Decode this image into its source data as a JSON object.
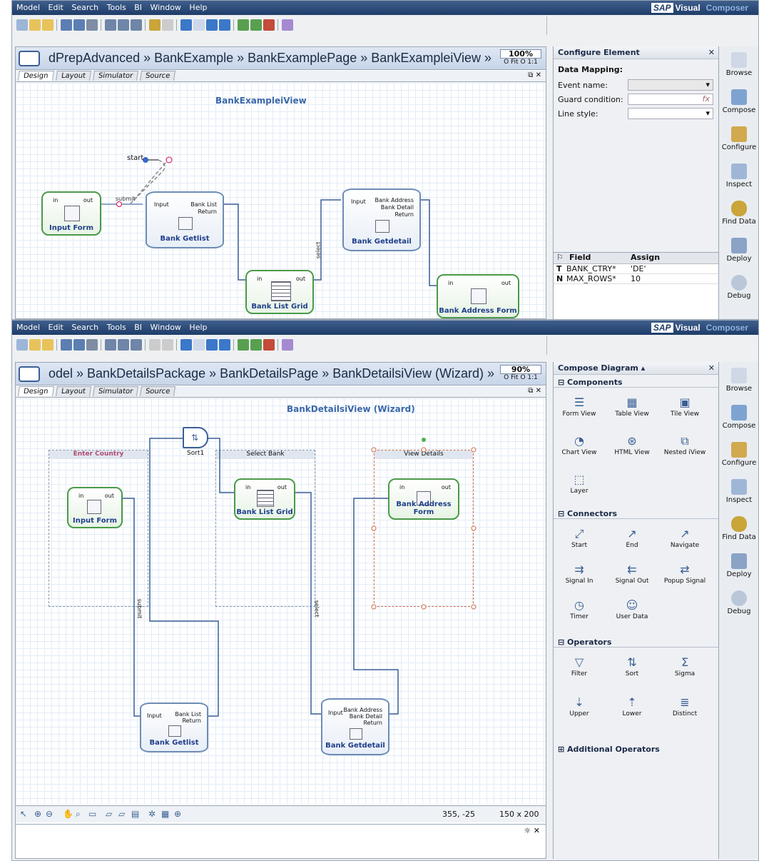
{
  "menu": [
    "Model",
    "Edit",
    "Search",
    "Tools",
    "BI",
    "Window",
    "Help"
  ],
  "brand": {
    "sap": "SAP",
    "vc_a": "Visual",
    "vc_b": "Composer"
  },
  "w1": {
    "breadcrumb": "dPrepAdvanced » BankExample » BankExamplePage » BankExampleiView »",
    "zoom": "100%",
    "fit": "O Fit  O 1:1",
    "tabs": [
      "Design",
      "Layout",
      "Simulator",
      "Source"
    ],
    "view_title": "BankExampleiView",
    "start": "start",
    "submit": "submit",
    "select": "select",
    "input_form": "Input Form",
    "bank_getlist": "Bank Getlist",
    "bank_list_grid": "Bank List Grid",
    "bank_getdetail": "Bank Getdetail",
    "bank_address_form": "Bank Address Form",
    "in": "in",
    "out": "out",
    "input": "Input",
    "bank_list": "Bank List",
    "return": "Return",
    "bank_address": "Bank Address",
    "bank_detail": "Bank Detail",
    "panel": {
      "title": "Configure Element",
      "data_mapping": "Data Mapping:",
      "event_name": "Event name:",
      "guard": "Guard condition:",
      "line_style": "Line style:",
      "fx": "fx",
      "col_field": "Field",
      "col_assign": "Assign",
      "rows": [
        {
          "t": "T",
          "field": "BANK_CTRY*",
          "assign": "'DE'"
        },
        {
          "t": "N",
          "field": "MAX_ROWS*",
          "assign": "10"
        }
      ]
    }
  },
  "w2": {
    "breadcrumb": "odel » BankDetailsPackage » BankDetailsPage » BankDetailsiView (Wizard) »",
    "zoom": "90%",
    "fit": "O Fit  O 1:1",
    "view_title": "BankDetailsiView (Wizard)",
    "enter_country": "Enter Country",
    "select_bank": "Select Bank",
    "view_details": "View Details",
    "sort": "Sort1",
    "submit": "submit",
    "select": "select",
    "status_pos": "355, -25",
    "status_size": "150 x 200",
    "panel": {
      "title": "Compose Diagram ▴",
      "components_h": "Components",
      "components": [
        "Form View",
        "Table View",
        "Tile View",
        "Chart View",
        "HTML View",
        "Nested iView",
        "Layer"
      ],
      "connectors_h": "Connectors",
      "connectors": [
        "Start",
        "End",
        "Navigate",
        "Signal In",
        "Signal Out",
        "Popup Signal",
        "Timer",
        "User Data"
      ],
      "operators_h": "Operators",
      "operators": [
        "Filter",
        "Sort",
        "Sigma",
        "Upper",
        "Lower",
        "Distinct"
      ],
      "additional": "Additional Operators"
    }
  },
  "side": [
    "Browse",
    "Compose",
    "Configure",
    "Inspect",
    "Find Data",
    "Deploy",
    "Debug"
  ]
}
